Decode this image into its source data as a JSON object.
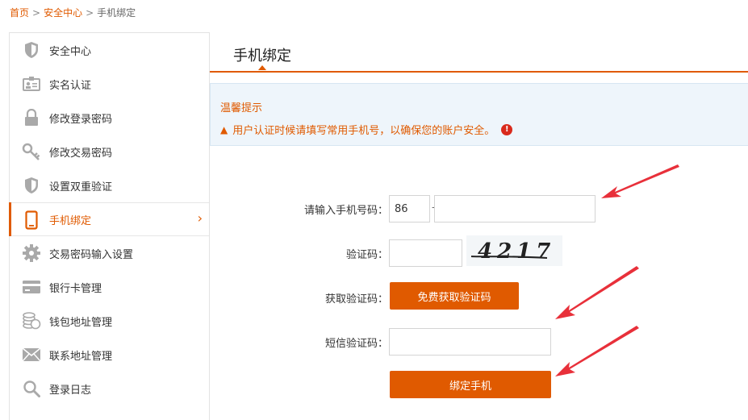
{
  "breadcrumb": {
    "home": "首页",
    "security": "安全中心",
    "current": "手机绑定",
    "separator": ">"
  },
  "sidebar": {
    "items": [
      {
        "label": "安全中心",
        "icon": "shield-icon"
      },
      {
        "label": "实名认证",
        "icon": "id-card-icon"
      },
      {
        "label": "修改登录密码",
        "icon": "lock-icon"
      },
      {
        "label": "修改交易密码",
        "icon": "key-icon"
      },
      {
        "label": "设置双重验证",
        "icon": "shield-half-icon"
      },
      {
        "label": "手机绑定",
        "icon": "phone-icon",
        "active": true
      },
      {
        "label": "交易密码输入设置",
        "icon": "gear-icon"
      },
      {
        "label": "银行卡管理",
        "icon": "bank-card-icon"
      },
      {
        "label": "钱包地址管理",
        "icon": "coins-icon"
      },
      {
        "label": "联系地址管理",
        "icon": "envelope-icon"
      },
      {
        "label": "登录日志",
        "icon": "search-icon"
      }
    ],
    "active_chevron": "›"
  },
  "page": {
    "title": "手机绑定"
  },
  "tips": {
    "title": "温馨提示",
    "text": "用户认证时候请填写常用手机号，以确保您的账户安全。",
    "warn_glyph": "▲",
    "info_glyph": "!"
  },
  "form": {
    "phone_label": "请输入手机号码：",
    "country_code": "86",
    "phone_value": "",
    "captcha_label": "验证码：",
    "captcha_value": "",
    "captcha_image_text": "4217",
    "get_code_label": "获取验证码：",
    "get_code_button": "免费获取验证码",
    "sms_label": "短信验证码：",
    "sms_value": "",
    "submit_button": "绑定手机"
  },
  "colors": {
    "accent": "#e05a00",
    "annotation_arrow": "#e8303a",
    "tips_bg": "#eef5fb"
  }
}
